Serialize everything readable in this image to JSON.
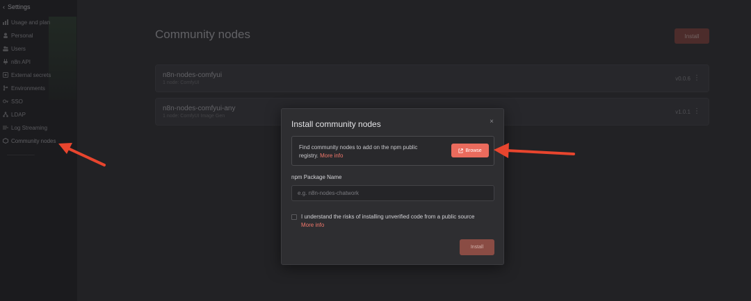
{
  "sidebar": {
    "header": "Settings",
    "items": [
      {
        "label": "Usage and plan",
        "icon": "chart-icon"
      },
      {
        "label": "Personal",
        "icon": "user-icon"
      },
      {
        "label": "Users",
        "icon": "users-icon"
      },
      {
        "label": "n8n API",
        "icon": "plug-icon"
      },
      {
        "label": "External secrets",
        "icon": "vault-icon"
      },
      {
        "label": "Environments",
        "icon": "branch-icon"
      },
      {
        "label": "SSO",
        "icon": "key-icon"
      },
      {
        "label": "LDAP",
        "icon": "network-icon"
      },
      {
        "label": "Log Streaming",
        "icon": "stream-icon"
      },
      {
        "label": "Community nodes",
        "icon": "cube-icon",
        "active": true
      }
    ]
  },
  "main": {
    "title": "Community nodes",
    "install_label": "Install",
    "nodes": [
      {
        "name": "n8n-nodes-comfyui",
        "sub": "1 node: ComfyUI",
        "version": "v0.0.6"
      },
      {
        "name": "n8n-nodes-comfyui-any",
        "sub": "1 node: ComfyUI Image Gen",
        "version": "v1.0.1"
      }
    ]
  },
  "modal": {
    "title": "Install community nodes",
    "close": "×",
    "info_text": "Find community nodes to add on the npm public registry.",
    "info_link": "More info",
    "browse_label": "Browse",
    "field_label": "npm Package Name",
    "field_placeholder": "e.g. n8n-nodes-chatwork",
    "checkbox_label": "I understand the risks of installing unverified code from a public source",
    "checkbox_link": "More info",
    "install_label": "Install"
  },
  "colors": {
    "accent": "#ea6b5d",
    "annotation_arrow": "#e8452e"
  }
}
